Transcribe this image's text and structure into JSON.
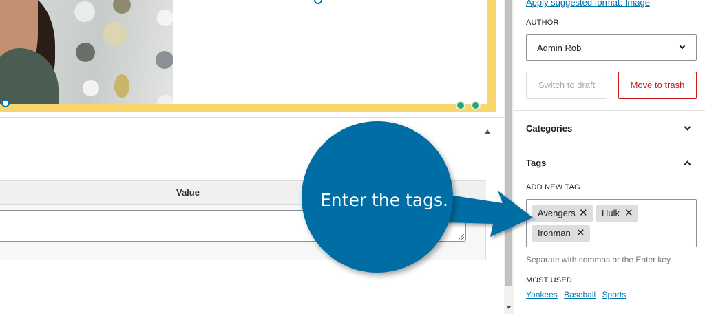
{
  "sidebar": {
    "suggest_link": "Apply suggested format: Image",
    "author_label": "AUTHOR",
    "author_value": "Admin Rob",
    "switch_to_draft": "Switch to draft",
    "move_to_trash": "Move to trash",
    "categories_title": "Categories",
    "tags_title": "Tags",
    "add_new_tag_label": "ADD NEW TAG",
    "tags": [
      "Avengers",
      "Hulk",
      "Ironman"
    ],
    "tag_remove_glyph": "✕",
    "help_text": "Separate with commas or the Enter key.",
    "most_used_label": "MOST USED",
    "most_used": [
      "Yankees",
      "Baseball",
      "Sports"
    ]
  },
  "main": {
    "custom_fields_value_header": "Value"
  },
  "annotation": {
    "text": "Enter the tags.",
    "color": "#006ea4"
  },
  "colors": {
    "image_border": "#f9d56e",
    "accent": "#0073aa",
    "danger": "#cc1818"
  }
}
